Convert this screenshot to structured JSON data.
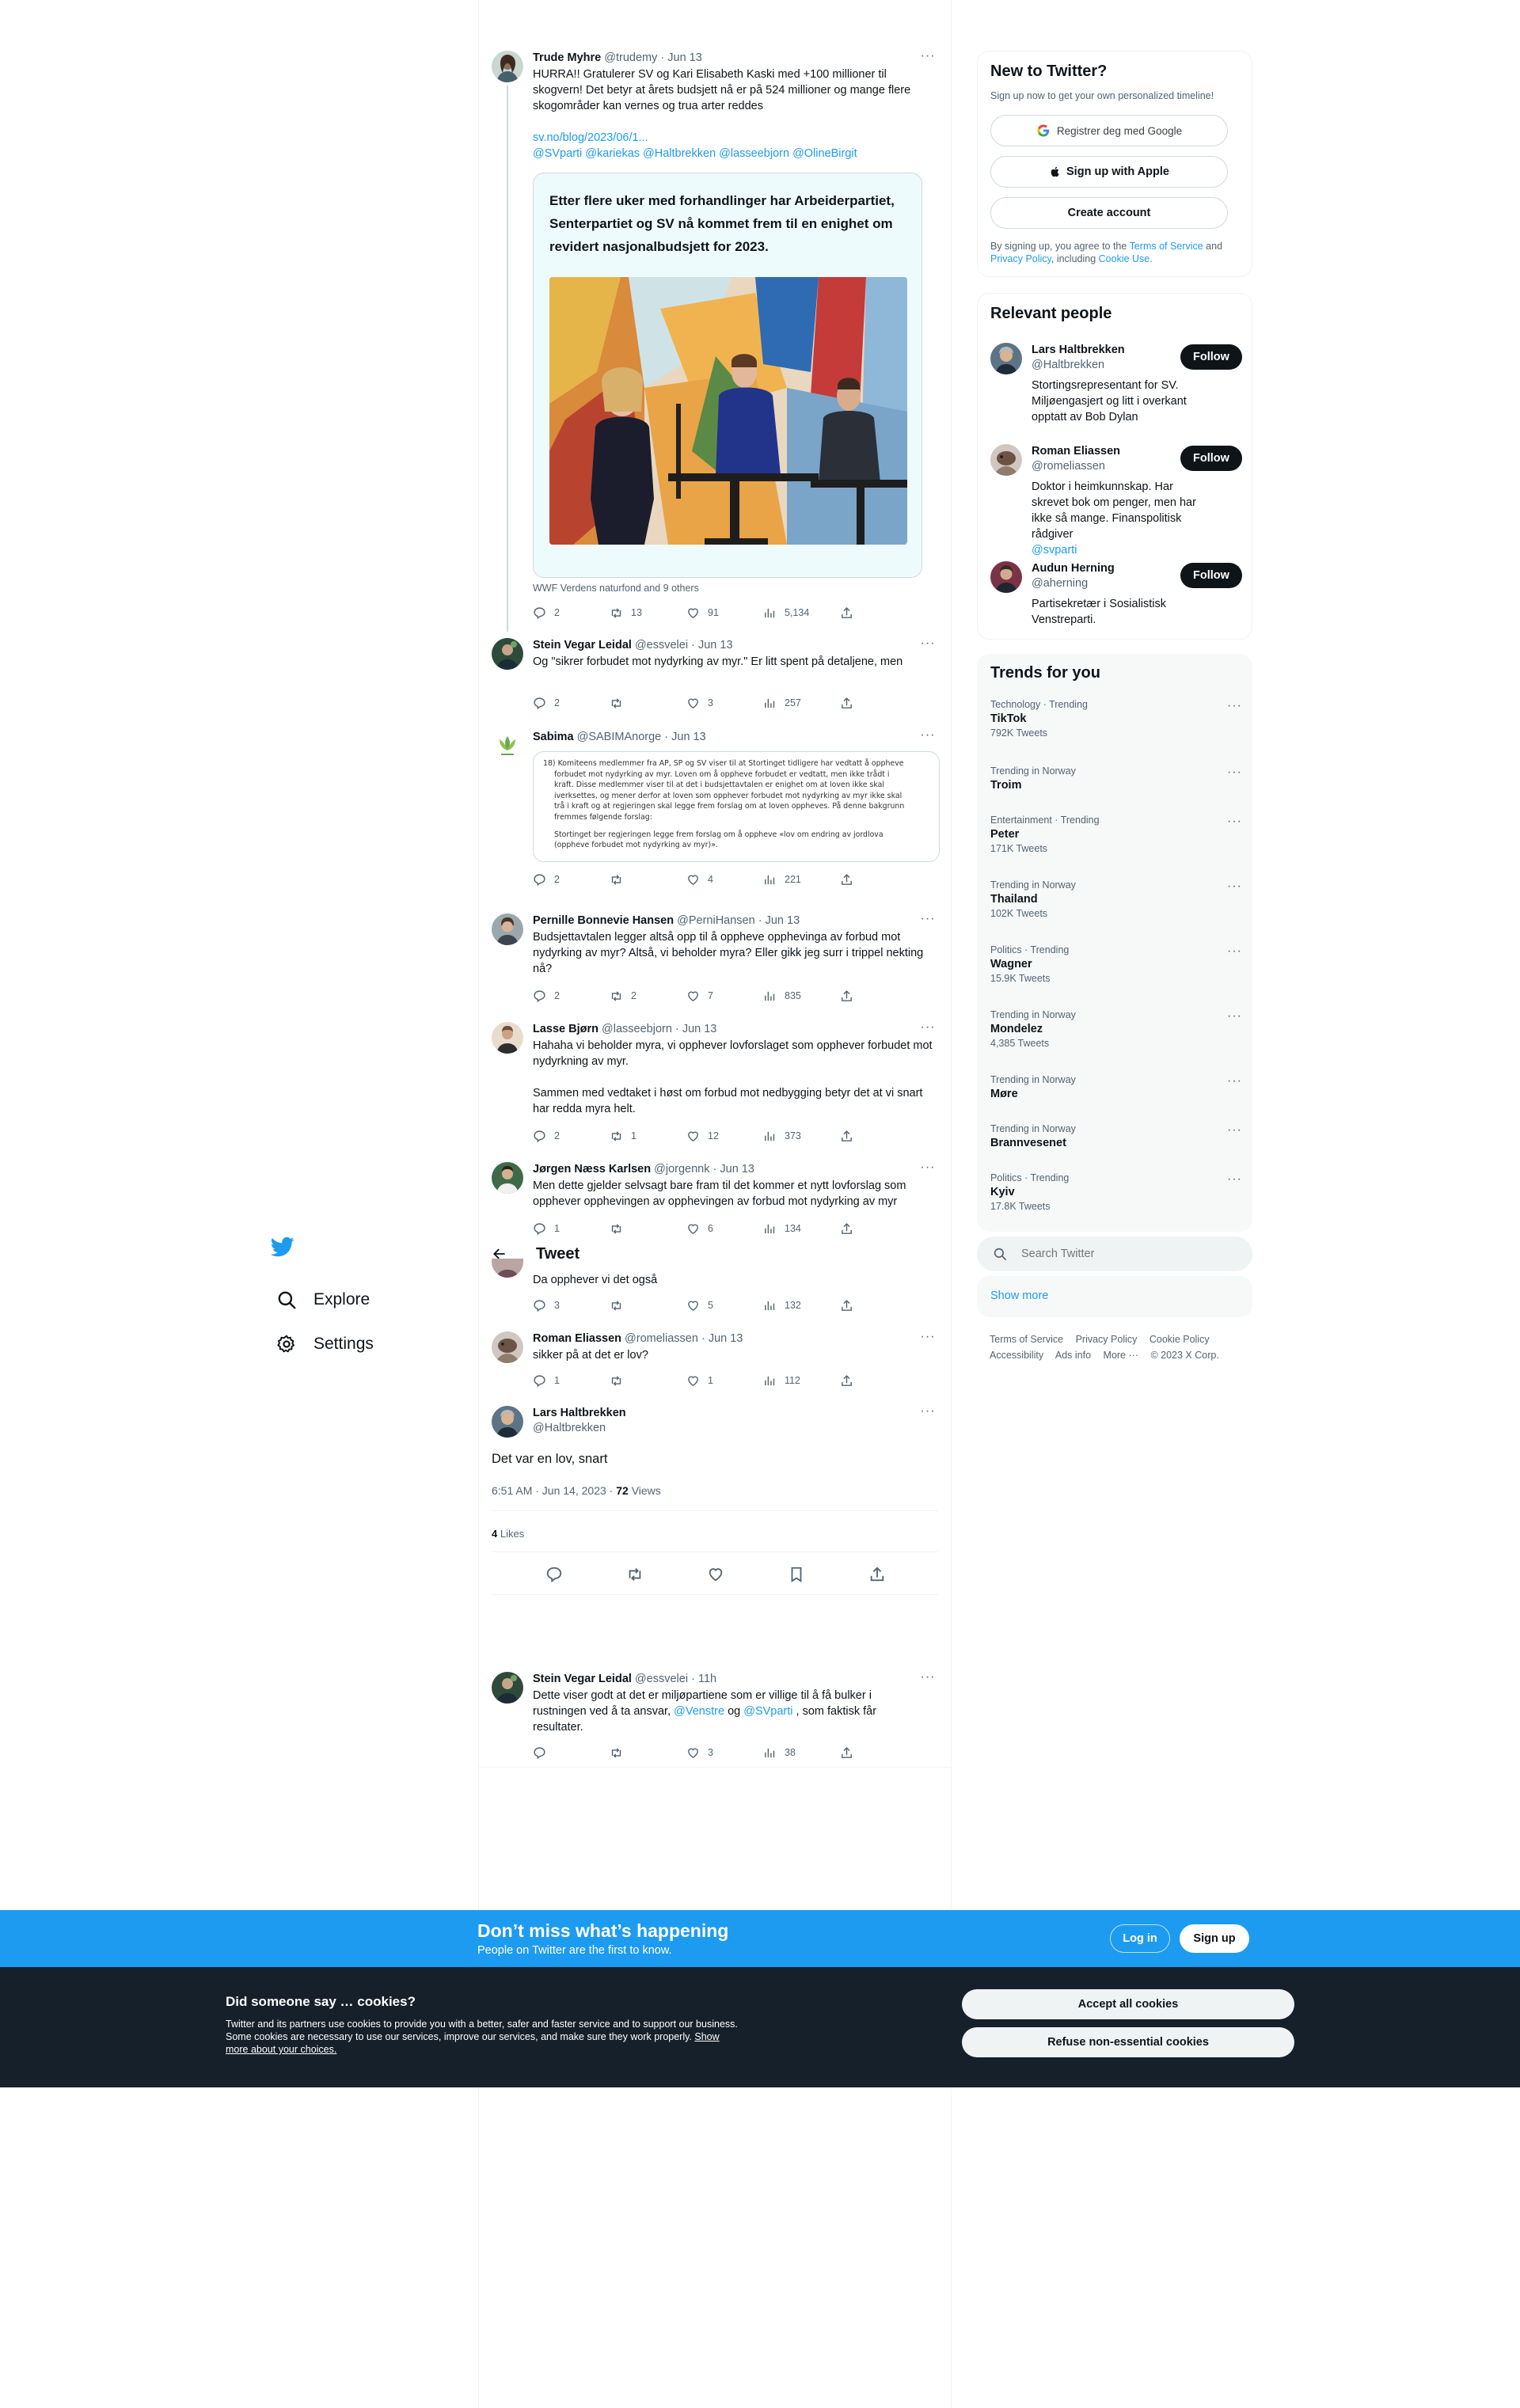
{
  "nav": {
    "logo": "twitter-bird-icon",
    "items": [
      {
        "label": "Explore",
        "icon": "search-icon"
      },
      {
        "label": "Settings",
        "icon": "gear-icon"
      }
    ]
  },
  "colors": {
    "accent": "#1d9bf0",
    "text": "#0f1419",
    "muted": "#536471",
    "dark": "#15202b"
  },
  "tweets": [
    {
      "name": "Trude Myhre",
      "handle": "@trudemy",
      "time": "Jun 13",
      "text": "HURRA!! Gratulerer SV og Kari Elisabeth Kaski med +100 millioner til skogvern! Det betyr at årets budsjett nå er på 524 millioner og mange flere skogområder kan vernes og trua arter reddes",
      "link": "sv.no/blog/2023/06/1...",
      "mentions": "@SVparti @kariekas @Haltbrekken @lasseebjorn @OlineBirgit",
      "quote_title": "Etter flere uker med forhandlinger har Arbeiderpartiet, Senterpartiet og SV nå kommet frem til en enighet om revidert nasjonalbudsjett for 2023.",
      "media_caption": "WWF Verdens naturfond and 9 others",
      "replies": "2",
      "retweets": "13",
      "likes": "91",
      "views": "5,134"
    },
    {
      "name": "Stein Vegar Leidal",
      "handle": "@essvelei",
      "time": "Jun 13",
      "text": "Og \"sikrer forbudet mot nydyrking av myr.\" Er litt spent på detaljene, men",
      "replies": "2",
      "retweets": "",
      "likes": "3",
      "views": "257"
    },
    {
      "name": "Sabima",
      "handle": "@SABIMAnorge",
      "time": "Jun 13",
      "doc_lines": [
        "18) Komiteens medlemmer fra AP, SP og SV viser til at Stortinget tidligere har vedtatt å oppheve",
        "forbudet mot nydyrking av myr. Loven om å oppheve forbudet er vedtatt, men ikke trådt i",
        "kraft. Disse medlemmer viser til at det i budsjettavtalen er enighet om at loven ikke skal",
        "iverksettes, og mener derfor at loven som opphever forbudet mot nydyrking av myr ikke skal",
        "trå i kraft og at regjeringen skal legge frem forslag om at loven oppheves. På denne bakgrunn",
        "fremmes følgende forslag:",
        "",
        "Stortinget ber regjeringen legge frem forslag om å oppheve «lov om endring av jordlova",
        "(oppheve forbudet mot nydyrking av myr)»."
      ],
      "replies": "2",
      "retweets": "",
      "likes": "4",
      "views": "221"
    },
    {
      "name": "Pernille Bonnevie Hansen",
      "handle": "@PerniHansen",
      "time": "Jun 13",
      "text": "Budsjettavtalen legger altså opp til å oppheve opphevinga av forbud mot nydyrking av myr? Altså, vi beholder myra? Eller gikk jeg surr i trippel nekting nå?",
      "replies": "2",
      "retweets": "2",
      "likes": "7",
      "views": "835"
    },
    {
      "name": "Lasse Bjørn",
      "handle": "@lasseebjorn",
      "time": "Jun 13",
      "text": "Hahaha vi beholder myra, vi opphever lovforslaget som opphever forbudet mot nydyrkning av myr.",
      "text2": "Sammen med vedtaket i høst om forbud mot nedbygging betyr det at vi snart har redda myra helt.",
      "replies": "2",
      "retweets": "1",
      "likes": "12",
      "views": "373"
    },
    {
      "name": "Jørgen Næss Karlsen",
      "handle": "@jorgennk",
      "time": "Jun 13",
      "text": "Men dette gjelder selvsagt bare fram til det kommer et nytt lovforslag som opphever opphevingen av opphevingen av forbud mot nydyrking av myr",
      "replies": "1",
      "retweets": "",
      "likes": "6",
      "views": "134"
    },
    {
      "text": "Da opphever vi det også",
      "replies": "3",
      "retweets": "",
      "likes": "5",
      "views": "132"
    },
    {
      "name": "Roman Eliassen",
      "handle": "@romeliassen",
      "time": "Jun 13",
      "text": "sikker på at det er lov?",
      "replies": "1",
      "retweets": "",
      "likes": "1",
      "views": "112"
    }
  ],
  "focused": {
    "header": "Tweet",
    "name": "Lars Haltbrekken",
    "handle": "@Haltbrekken",
    "text": "Det var en lov, snart",
    "timestamp": "6:51 AM · Jun 14, 2023",
    "views_count": "72",
    "views_label": "Views",
    "likes_count": "4",
    "likes_label": "Likes"
  },
  "reply_below": {
    "name": "Stein Vegar Leidal",
    "handle": "@essvelei",
    "time": "11h",
    "text_a": "Dette viser godt at det er miljøpartiene som er villige til å få bulker i rustningen ved å ta ansvar, ",
    "mention1": "@Venstre",
    "text_b": " og ",
    "mention2": "@SVparti",
    "text_c": " , som faktisk får resultater.",
    "replies": "",
    "retweets": "",
    "likes": "3",
    "views": "38"
  },
  "new_to_twitter": {
    "title": "New to Twitter?",
    "subtitle": "Sign up now to get your own personalized timeline!",
    "google": "Registrer deg med Google",
    "apple": "Sign up with Apple",
    "create": "Create account",
    "terms_a": "By signing up, you agree to the ",
    "terms_link": "Terms of Service",
    "terms_b": " and ",
    "privacy_link": "Privacy Policy",
    "terms_c": ", including ",
    "cookie_link": "Cookie Use",
    "terms_d": "."
  },
  "relevant_people": {
    "title": "Relevant people",
    "follow_label": "Follow",
    "people": [
      {
        "name": "Lars Haltbrekken",
        "handle": "@Haltbrekken",
        "bio": "Stortingsrepresentant for SV. Miljøengasjert og litt i overkant opptatt av Bob Dylan"
      },
      {
        "name": "Roman Eliassen",
        "handle": "@romeliassen",
        "bio": "Doktor i heimkunnskap. Har skrevet bok om penger, men har ikke så mange. Finanspolitisk rådgiver",
        "bio_link": "@svparti"
      },
      {
        "name": "Audun Herning",
        "handle": "@aherning",
        "bio": "Partisekretær i Sosialistisk Venstreparti."
      }
    ]
  },
  "trends": {
    "title": "Trends for you",
    "items": [
      {
        "category": "Technology · Trending",
        "name": "TikTok",
        "count": "792K Tweets"
      },
      {
        "category": "Trending in Norway",
        "name": "Troim",
        "count": ""
      },
      {
        "category": "Entertainment · Trending",
        "name": "Peter",
        "count": "171K Tweets"
      },
      {
        "category": "Trending in Norway",
        "name": "Thailand",
        "count": "102K Tweets"
      },
      {
        "category": "Politics · Trending",
        "name": "Wagner",
        "count": "15.9K Tweets"
      },
      {
        "category": "Trending in Norway",
        "name": "Mondelez",
        "count": "4,385 Tweets"
      },
      {
        "category": "Trending in Norway",
        "name": "Møre",
        "count": ""
      },
      {
        "category": "Trending in Norway",
        "name": "Brannvesenet",
        "count": ""
      },
      {
        "category": "Politics · Trending",
        "name": "Kyiv",
        "count": "17.8K Tweets"
      }
    ]
  },
  "search": {
    "placeholder": "Search Twitter",
    "show_more": "Show more"
  },
  "footer": {
    "row1": [
      "Terms of Service",
      "Privacy Policy",
      "Cookie Policy"
    ],
    "row2": [
      "Accessibility",
      "Ads info",
      "More ···",
      "© 2023 X Corp."
    ]
  },
  "signup_banner": {
    "title": "Don’t miss what’s happening",
    "subtitle": "People on Twitter are the first to know.",
    "login": "Log in",
    "signup": "Sign up"
  },
  "cookie_banner": {
    "title": "Did someone say … cookies?",
    "text": "Twitter and its partners use cookies to provide you with a better, safer and faster service and to support our business. Some cookies are necessary to use our services, improve our services, and make sure they work properly. ",
    "link": "Show more about your choices.",
    "accept": "Accept all cookies",
    "refuse": "Refuse non-essential cookies"
  }
}
